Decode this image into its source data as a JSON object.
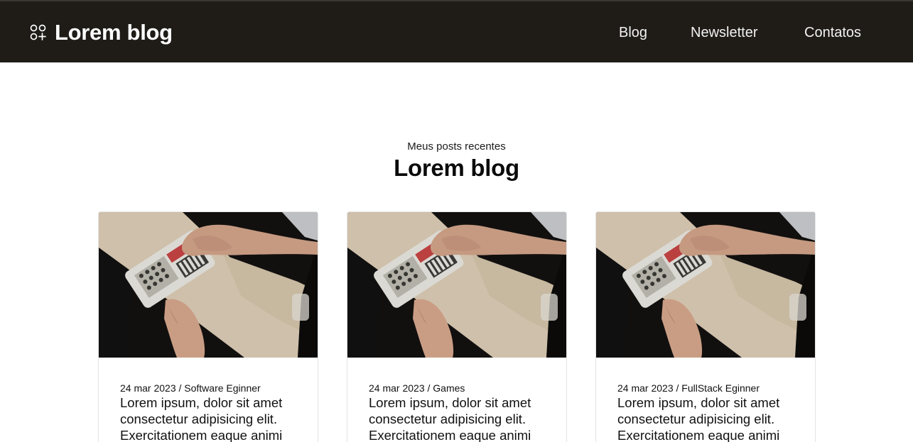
{
  "header": {
    "brand": {
      "icon": "circles-plus-icon",
      "title": "Lorem blog"
    },
    "nav": [
      {
        "label": "Blog"
      },
      {
        "label": "Newsletter"
      },
      {
        "label": "Contatos"
      }
    ],
    "colors": {
      "background": "#1f1c18",
      "text": "#ffffff"
    }
  },
  "section": {
    "subtitle": "Meus posts recentes",
    "title": "Lorem blog"
  },
  "posts": [
    {
      "date": "24 mar 2023",
      "separator": " / ",
      "category": "Software Eginner",
      "text": "Lorem ipsum, dolor sit amet consectetur adipisicing elit. Exercitationem eaque animi",
      "image": "hands-on-synthesizer-photo"
    },
    {
      "date": "24 mar 2023",
      "separator": " / ",
      "category": "Games",
      "text": "Lorem ipsum, dolor sit amet consectetur adipisicing elit. Exercitationem eaque animi",
      "image": "hands-on-synthesizer-photo"
    },
    {
      "date": "24 mar 2023",
      "separator": " / ",
      "category": "FullStack Eginner",
      "text": "Lorem ipsum, dolor sit amet consectetur adipisicing elit. Exercitationem eaque animi",
      "image": "hands-on-synthesizer-photo"
    }
  ]
}
